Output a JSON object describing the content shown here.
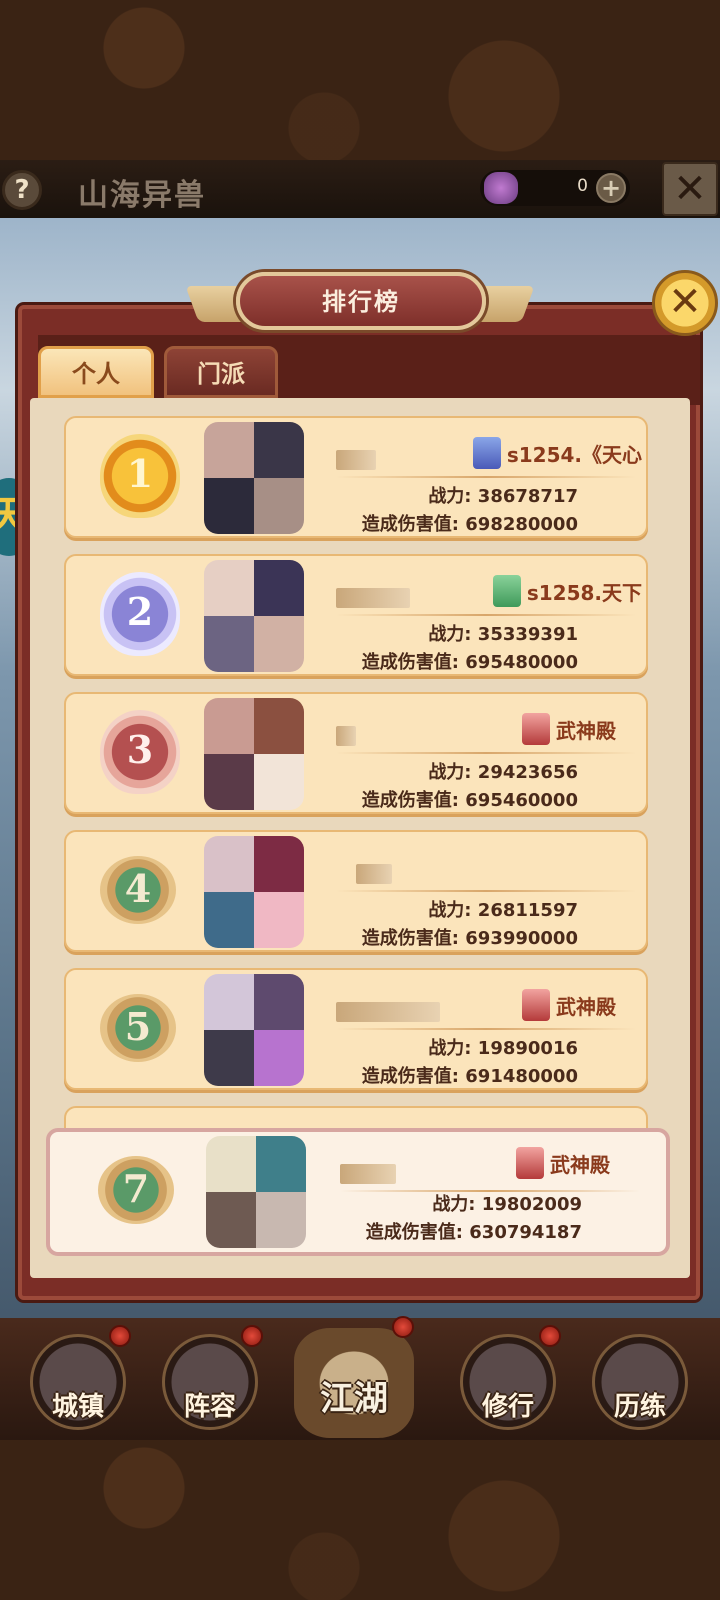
{
  "topbar": {
    "help": "?",
    "title": "山海异兽",
    "currency_value": "0",
    "plus": "+",
    "close": "✕"
  },
  "side_badge": "天",
  "panel": {
    "title": "排行榜",
    "close": "✕",
    "tabs": [
      {
        "label": "个人",
        "active": true
      },
      {
        "label": "门派",
        "active": false
      }
    ]
  },
  "ranking": [
    {
      "rank": "1",
      "sect": "s1254.《天心",
      "sect_color": "blue",
      "power_label": "战力:",
      "power": "38678717",
      "damage_label": "造成伤害值:",
      "damage": "698280000"
    },
    {
      "rank": "2",
      "sect": "s1258.天下",
      "sect_color": "green",
      "power_label": "战力:",
      "power": "35339391",
      "damage_label": "造成伤害值:",
      "damage": "695480000"
    },
    {
      "rank": "3",
      "sect": "武神殿",
      "sect_color": "red",
      "power_label": "战力:",
      "power": "29423656",
      "damage_label": "造成伤害值:",
      "damage": "695460000"
    },
    {
      "rank": "4",
      "sect": "",
      "sect_color": "",
      "power_label": "战力:",
      "power": "26811597",
      "damage_label": "造成伤害值:",
      "damage": "693990000"
    },
    {
      "rank": "5",
      "sect": "武神殿",
      "sect_color": "red",
      "power_label": "战力:",
      "power": "19890016",
      "damage_label": "造成伤害值:",
      "damage": "691480000"
    }
  ],
  "self_rank": {
    "rank": "7",
    "sect": "武神殿",
    "sect_color": "red",
    "power_label": "战力:",
    "power": "19802009",
    "damage_label": "造成伤害值:",
    "damage": "630794187"
  },
  "bottom_nav": [
    {
      "label": "城镇"
    },
    {
      "label": "阵容"
    },
    {
      "label": "江湖"
    },
    {
      "label": "修行"
    },
    {
      "label": "历练"
    }
  ]
}
